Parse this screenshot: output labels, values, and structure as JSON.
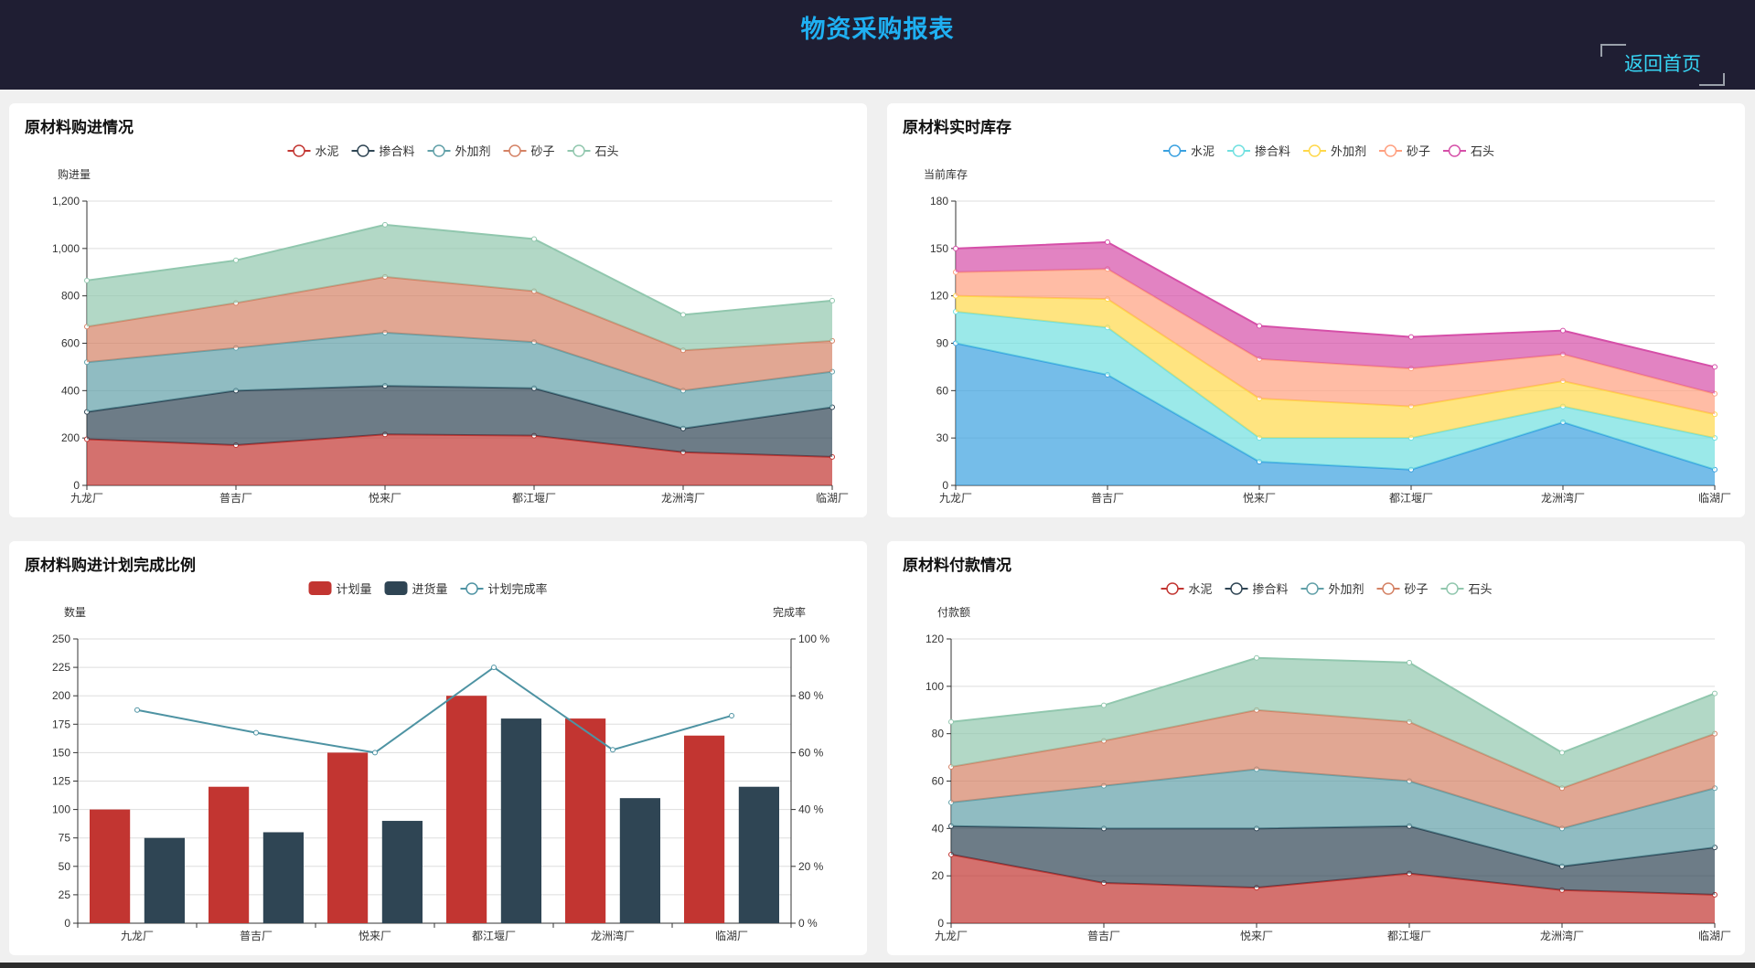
{
  "header": {
    "title": "物资采购报表",
    "back_label": "返回首页"
  },
  "colors": {
    "cement": "#c23531",
    "admixture_material": "#2f4554",
    "additive": "#61a0a8",
    "sand": "#d48265",
    "stone": "#91c7ae",
    "stock_cement": "#3aa1e0",
    "stock_admixture": "#70e0e0",
    "stock_additive": "#ffd84a",
    "stock_sand": "#ff9f7f",
    "stock_stone": "#d54fa8",
    "rate_line": "#4e93a3"
  },
  "panels": {
    "purchase": {
      "title": "原材料购进情况"
    },
    "stock": {
      "title": "原材料实时库存"
    },
    "plan": {
      "title": "原材料购进计划完成比例"
    },
    "payment": {
      "title": "原材料付款情况"
    }
  },
  "chart_data": [
    {
      "id": "purchase",
      "type": "area",
      "stacked": true,
      "title": "原材料购进情况",
      "ylabel": "购进量",
      "ylim": [
        0,
        1200
      ],
      "yticks": [
        "0",
        "200",
        "400",
        "600",
        "800",
        "1,000",
        "1,200"
      ],
      "ytick_values": [
        0,
        200,
        400,
        600,
        800,
        1000,
        1200
      ],
      "categories": [
        "九龙厂",
        "普吉厂",
        "悦来厂",
        "都江堰厂",
        "龙洲湾厂",
        "临湖厂"
      ],
      "legend_placement": "top-center",
      "grid": true,
      "series": [
        {
          "name": "水泥",
          "color_key": "cement",
          "values": [
            195,
            170,
            215,
            210,
            140,
            120
          ]
        },
        {
          "name": "掺合料",
          "color_key": "admixture_material",
          "values": [
            115,
            230,
            205,
            200,
            100,
            210
          ]
        },
        {
          "name": "外加剂",
          "color_key": "additive",
          "values": [
            210,
            180,
            225,
            195,
            160,
            150
          ]
        },
        {
          "name": "砂子",
          "color_key": "sand",
          "values": [
            150,
            190,
            235,
            215,
            170,
            130
          ]
        },
        {
          "name": "石头",
          "color_key": "stone",
          "values": [
            195,
            180,
            220,
            220,
            150,
            170
          ]
        }
      ]
    },
    {
      "id": "stock",
      "type": "area",
      "stacked": true,
      "title": "原材料实时库存",
      "ylabel": "当前库存",
      "ylim": [
        0,
        180
      ],
      "yticks": [
        "0",
        "30",
        "60",
        "90",
        "120",
        "150",
        "180"
      ],
      "ytick_values": [
        0,
        30,
        60,
        90,
        120,
        150,
        180
      ],
      "categories": [
        "九龙厂",
        "普吉厂",
        "悦来厂",
        "都江堰厂",
        "龙洲湾厂",
        "临湖厂"
      ],
      "legend_placement": "top-center",
      "grid": true,
      "series": [
        {
          "name": "水泥",
          "color_key": "stock_cement",
          "values": [
            90,
            70,
            15,
            10,
            40,
            10
          ]
        },
        {
          "name": "掺合料",
          "color_key": "stock_admixture",
          "values": [
            20,
            30,
            15,
            20,
            10,
            20
          ]
        },
        {
          "name": "外加剂",
          "color_key": "stock_additive",
          "values": [
            10,
            18,
            25,
            20,
            16,
            15
          ]
        },
        {
          "name": "砂子",
          "color_key": "stock_sand",
          "values": [
            15,
            19,
            25,
            24,
            17,
            13
          ]
        },
        {
          "name": "石头",
          "color_key": "stock_stone",
          "values": [
            15,
            17,
            21,
            20,
            15,
            17
          ]
        }
      ]
    },
    {
      "id": "plan",
      "type": "bar",
      "title": "原材料购进计划完成比例",
      "ylabel": "数量",
      "y2label": "完成率",
      "ylim": [
        0,
        250
      ],
      "yticks": [
        "0",
        "25",
        "50",
        "75",
        "100",
        "125",
        "150",
        "175",
        "200",
        "225",
        "250"
      ],
      "ytick_values": [
        0,
        25,
        50,
        75,
        100,
        125,
        150,
        175,
        200,
        225,
        250
      ],
      "y2lim": [
        0,
        100
      ],
      "y2ticks": [
        "0 %",
        "20 %",
        "40 %",
        "60 %",
        "80 %",
        "100 %"
      ],
      "y2tick_values": [
        0,
        20,
        40,
        60,
        80,
        100
      ],
      "categories": [
        "九龙厂",
        "普吉厂",
        "悦来厂",
        "都江堰厂",
        "龙洲湾厂",
        "临湖厂"
      ],
      "legend_placement": "top-center",
      "grid": true,
      "series": [
        {
          "name": "计划量",
          "kind": "bar",
          "color_key": "cement",
          "values": [
            100,
            120,
            150,
            200,
            180,
            165
          ]
        },
        {
          "name": "进货量",
          "kind": "bar",
          "color_key": "admixture_material",
          "values": [
            75,
            80,
            90,
            180,
            110,
            120
          ]
        },
        {
          "name": "计划完成率",
          "kind": "line",
          "axis": "right",
          "color_key": "rate_line",
          "values": [
            75,
            67,
            60,
            90,
            61,
            73
          ]
        }
      ]
    },
    {
      "id": "payment",
      "type": "area",
      "stacked": true,
      "title": "原材料付款情况",
      "ylabel": "付款额",
      "ylim": [
        0,
        120
      ],
      "yticks": [
        "0",
        "20",
        "40",
        "60",
        "80",
        "100",
        "120"
      ],
      "ytick_values": [
        0,
        20,
        40,
        60,
        80,
        100,
        120
      ],
      "categories": [
        "九龙厂",
        "普吉厂",
        "悦来厂",
        "都江堰厂",
        "龙洲湾厂",
        "临湖厂"
      ],
      "legend_placement": "top-center",
      "grid": true,
      "series": [
        {
          "name": "水泥",
          "color_key": "cement",
          "values": [
            29,
            17,
            15,
            21,
            14,
            12
          ]
        },
        {
          "name": "掺合料",
          "color_key": "admixture_material",
          "values": [
            12,
            23,
            25,
            20,
            10,
            20
          ]
        },
        {
          "name": "外加剂",
          "color_key": "additive",
          "values": [
            10,
            18,
            25,
            19,
            16,
            25
          ]
        },
        {
          "name": "砂子",
          "color_key": "sand",
          "values": [
            15,
            19,
            25,
            25,
            17,
            23
          ]
        },
        {
          "name": "石头",
          "color_key": "stone",
          "values": [
            19,
            15,
            22,
            25,
            15,
            17
          ]
        }
      ]
    }
  ]
}
